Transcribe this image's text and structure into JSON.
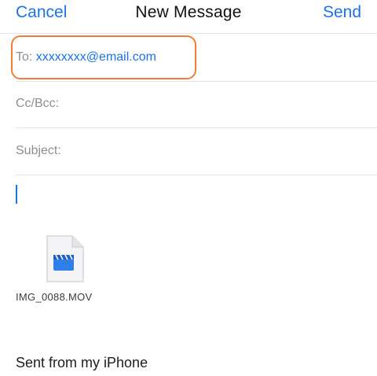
{
  "navbar": {
    "cancel_label": "Cancel",
    "title": "New Message",
    "send_label": "Send"
  },
  "fields": {
    "to_label": "To:",
    "to_value": "xxxxxxxx@email.com",
    "cc_label": "Cc/Bcc:",
    "subject_label": "Subject:"
  },
  "attachment": {
    "icon": "video-file-icon",
    "file_name": "IMG_0088.MOV"
  },
  "body": {
    "signature": "Sent from my iPhone"
  },
  "colors": {
    "accent": "#1a73e8",
    "highlight": "#f07d3a",
    "label": "#8e8e93"
  }
}
